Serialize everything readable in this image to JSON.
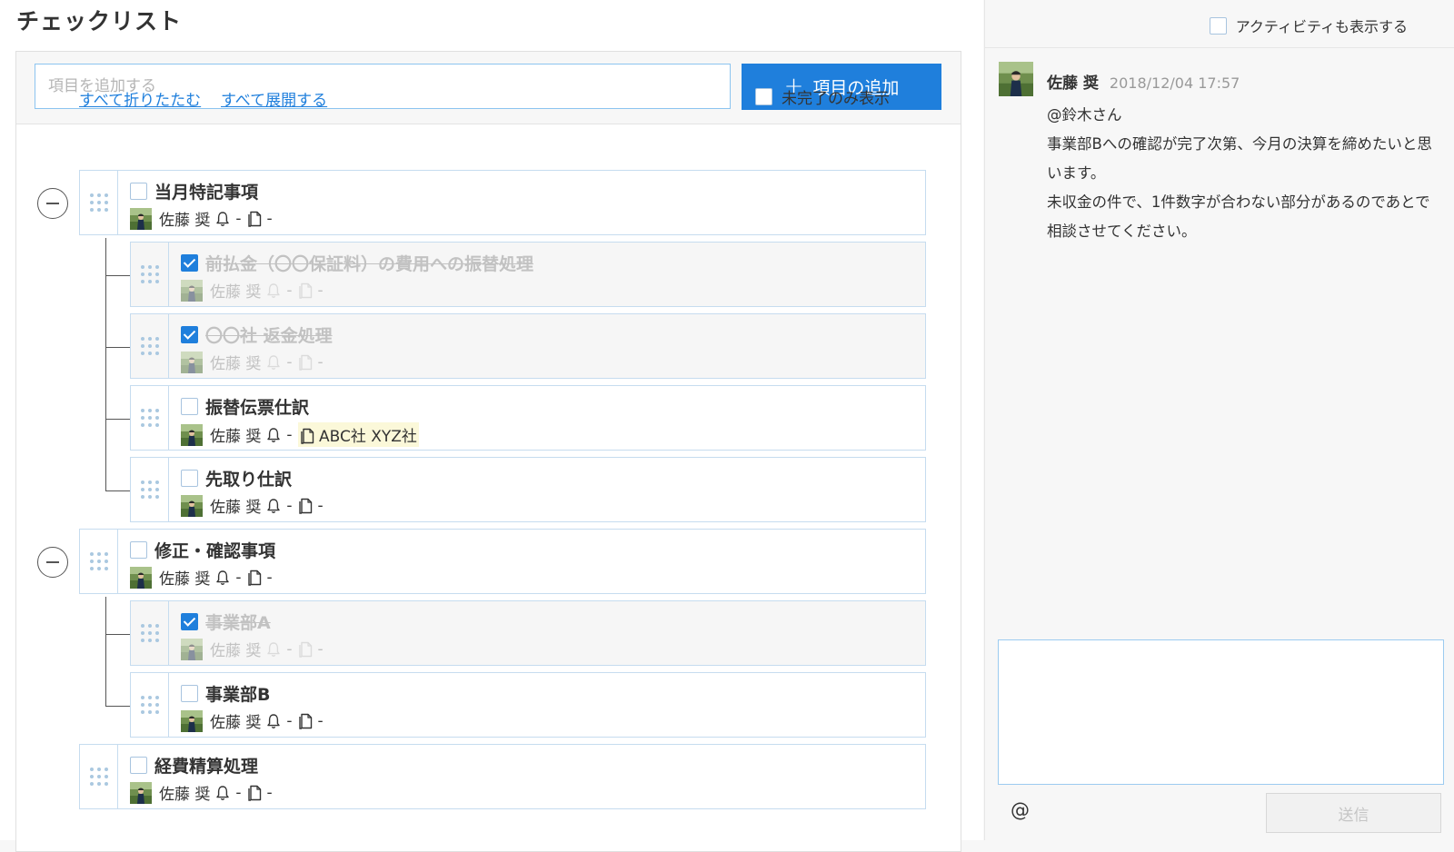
{
  "page": {
    "title": "チェックリスト"
  },
  "add_bar": {
    "placeholder": "項目を追加する",
    "button_label": "項目の追加"
  },
  "controls": {
    "collapse_all": "すべて折りたたむ",
    "expand_all": "すべて展開する",
    "incomplete_only": "未完了のみ表示"
  },
  "items": [
    {
      "title": "当月特記事項",
      "checked": false,
      "assignee": "佐藤 奨",
      "reminder": "-",
      "attachment": "-"
    },
    {
      "title": "前払金（〇〇保証料）の費用への振替処理",
      "checked": true,
      "assignee": "佐藤 奨",
      "reminder": "-",
      "attachment": "-"
    },
    {
      "title": "〇〇社 返金処理",
      "checked": true,
      "assignee": "佐藤 奨",
      "reminder": "-",
      "attachment": "-"
    },
    {
      "title": "振替伝票仕訳",
      "checked": false,
      "assignee": "佐藤 奨",
      "reminder": "-",
      "attachment": "ABC社 XYZ社"
    },
    {
      "title": "先取り仕訳",
      "checked": false,
      "assignee": "佐藤 奨",
      "reminder": "-",
      "attachment": "-"
    },
    {
      "title": "修正・確認事項",
      "checked": false,
      "assignee": "佐藤 奨",
      "reminder": "-",
      "attachment": "-"
    },
    {
      "title": "事業部A",
      "checked": true,
      "assignee": "佐藤 奨",
      "reminder": "-",
      "attachment": "-"
    },
    {
      "title": "事業部B",
      "checked": false,
      "assignee": "佐藤 奨",
      "reminder": "-",
      "attachment": "-"
    },
    {
      "title": "経費精算処理",
      "checked": false,
      "assignee": "佐藤 奨",
      "reminder": "-",
      "attachment": "-"
    }
  ],
  "activity": {
    "show_activity_label": "アクティビティも表示する",
    "comment": {
      "author": "佐藤 奨",
      "timestamp": "2018/12/04 17:57",
      "lines": [
        "@鈴木さん",
        "事業部Bへの確認が完了次第、今月の決算を締めたいと思います。",
        "未収金の件で、1件数字が合わない部分があるのであとで相談させてください。"
      ]
    },
    "mention_label": "@",
    "send_label": "送信"
  }
}
